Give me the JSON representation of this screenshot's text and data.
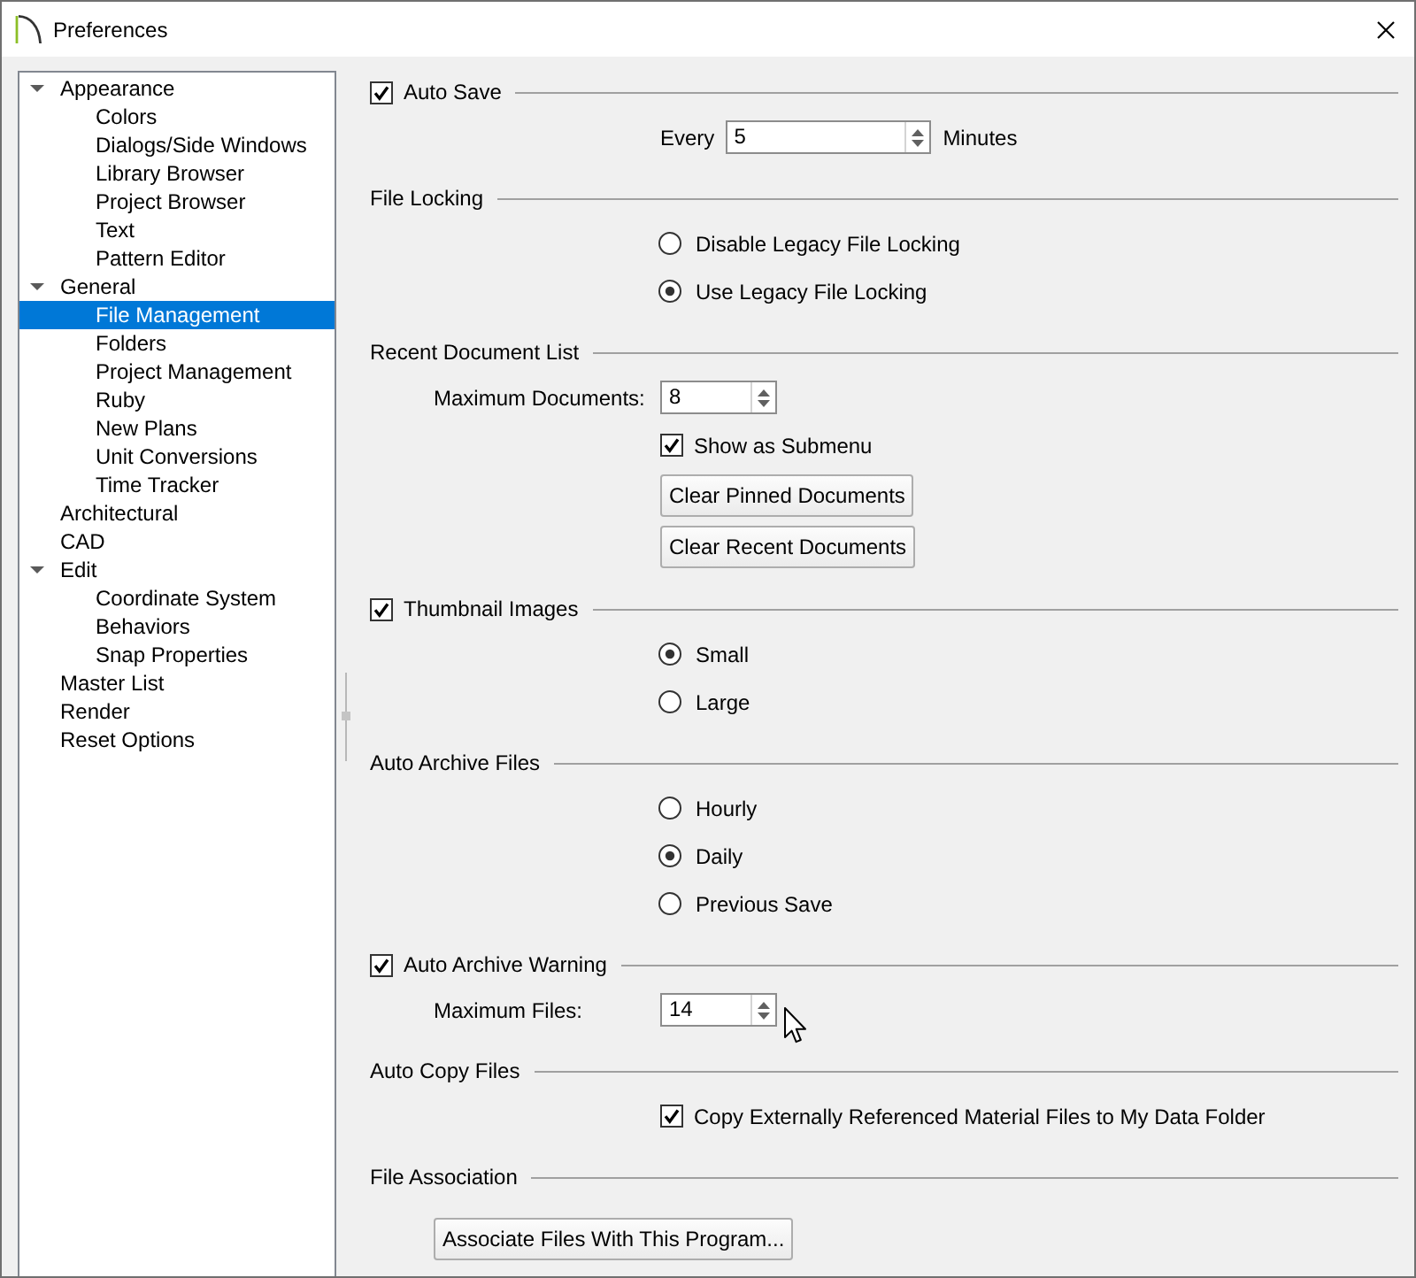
{
  "window": {
    "title": "Preferences"
  },
  "sidebar": {
    "items": [
      {
        "label": "Appearance",
        "expanded": true,
        "selected": false,
        "children": [
          {
            "label": "Colors",
            "selected": false
          },
          {
            "label": "Dialogs/Side Windows",
            "selected": false
          },
          {
            "label": "Library Browser",
            "selected": false
          },
          {
            "label": "Project Browser",
            "selected": false
          },
          {
            "label": "Text",
            "selected": false
          },
          {
            "label": "Pattern Editor",
            "selected": false
          }
        ]
      },
      {
        "label": "General",
        "expanded": true,
        "selected": false,
        "children": [
          {
            "label": "File Management",
            "selected": true
          },
          {
            "label": "Folders",
            "selected": false
          },
          {
            "label": "Project Management",
            "selected": false
          },
          {
            "label": "Ruby",
            "selected": false
          },
          {
            "label": "New Plans",
            "selected": false
          },
          {
            "label": "Unit Conversions",
            "selected": false
          },
          {
            "label": "Time Tracker",
            "selected": false
          }
        ]
      },
      {
        "label": "Architectural",
        "selected": false
      },
      {
        "label": "CAD",
        "selected": false
      },
      {
        "label": "Edit",
        "expanded": true,
        "selected": false,
        "children": [
          {
            "label": "Coordinate System",
            "selected": false
          },
          {
            "label": "Behaviors",
            "selected": false
          },
          {
            "label": "Snap Properties",
            "selected": false
          }
        ]
      },
      {
        "label": "Master List",
        "selected": false
      },
      {
        "label": "Render",
        "selected": false
      },
      {
        "label": "Reset Options",
        "selected": false
      }
    ]
  },
  "sections": [
    {
      "kind": "checkbox_header",
      "label": "Auto Save",
      "checked": true,
      "controls": [
        {
          "kind": "spinbox",
          "prefix": "Every",
          "value": "5",
          "suffix": "Minutes"
        }
      ]
    },
    {
      "kind": "header",
      "label": "File Locking",
      "controls": [
        {
          "kind": "radio",
          "label": "Disable Legacy File Locking",
          "selected": false
        },
        {
          "kind": "radio",
          "label": "Use Legacy File Locking",
          "selected": true
        }
      ]
    },
    {
      "kind": "header",
      "label": "Recent Document List",
      "controls": [
        {
          "kind": "labeled_spinbox",
          "label": "Maximum Documents:",
          "value": "8"
        },
        {
          "kind": "checkbox",
          "label": "Show as Submenu",
          "checked": true
        },
        {
          "kind": "button",
          "label": "Clear Pinned Documents"
        },
        {
          "kind": "button",
          "label": "Clear Recent Documents"
        }
      ]
    },
    {
      "kind": "checkbox_header",
      "label": "Thumbnail Images",
      "checked": true,
      "controls": [
        {
          "kind": "radio",
          "label": "Small",
          "selected": true
        },
        {
          "kind": "radio",
          "label": "Large",
          "selected": false
        }
      ]
    },
    {
      "kind": "header",
      "label": "Auto Archive Files",
      "controls": [
        {
          "kind": "radio",
          "label": "Hourly",
          "selected": false
        },
        {
          "kind": "radio",
          "label": "Daily",
          "selected": true
        },
        {
          "kind": "radio",
          "label": "Previous Save",
          "selected": false
        }
      ]
    },
    {
      "kind": "checkbox_header",
      "label": "Auto Archive Warning",
      "checked": true,
      "controls": [
        {
          "kind": "labeled_spinbox",
          "label": "Maximum Files:",
          "value": "14"
        }
      ]
    },
    {
      "kind": "header",
      "label": "Auto Copy Files",
      "controls": [
        {
          "kind": "checkbox",
          "label": "Copy Externally Referenced Material Files to My Data Folder",
          "checked": true
        }
      ]
    },
    {
      "kind": "header",
      "label": "File Association",
      "controls": [
        {
          "kind": "wide_button",
          "label": "Associate Files With This Program..."
        }
      ]
    }
  ]
}
